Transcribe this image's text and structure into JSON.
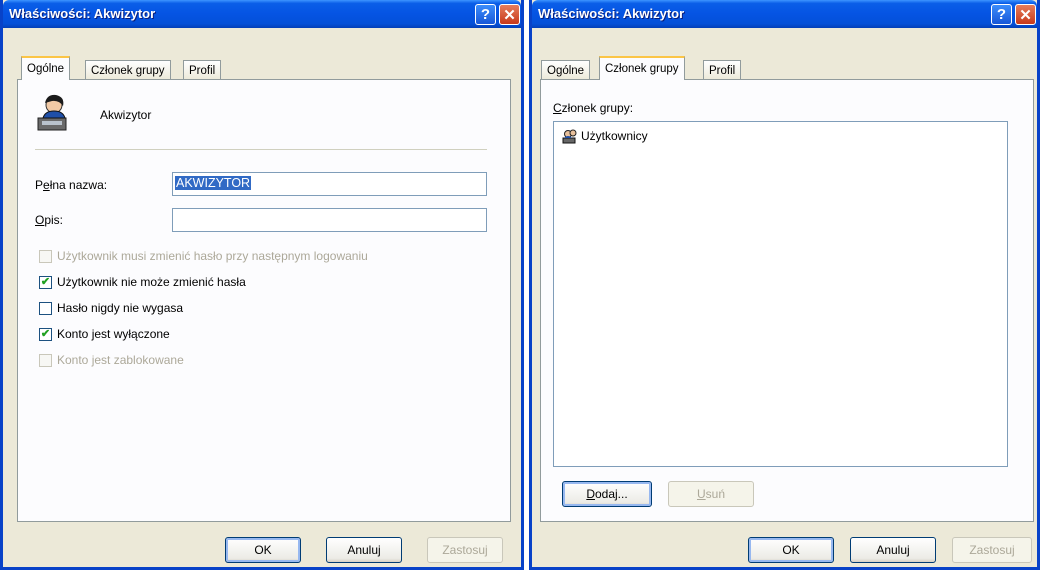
{
  "window1": {
    "title": "Właściwości: Akwizytor",
    "tabs": [
      "Ogólne",
      "Członek grupy",
      "Profil"
    ],
    "active_tab": "Ogólne",
    "user_name": "Akwizytor",
    "full_name_label": "Pełna nazwa:",
    "full_name_value": "AKWIZYTOR",
    "description_label": "Opis:",
    "description_value": "",
    "checkboxes": [
      {
        "label": "Użytkownik musi zmienić hasło przy następnym logowaniu",
        "checked": false,
        "enabled": false
      },
      {
        "label": "Użytkownik nie może zmienić hasła",
        "checked": true,
        "enabled": true
      },
      {
        "label": "Hasło nigdy nie wygasa",
        "checked": false,
        "enabled": true
      },
      {
        "label": "Konto jest wyłączone",
        "checked": true,
        "enabled": true
      },
      {
        "label": "Konto jest zablokowane",
        "checked": false,
        "enabled": false
      }
    ],
    "buttons": {
      "ok": "OK",
      "cancel": "Anuluj",
      "apply": "Zastosuj"
    }
  },
  "window2": {
    "title": "Właściwości: Akwizytor",
    "tabs": [
      "Ogólne",
      "Członek grupy",
      "Profil"
    ],
    "active_tab": "Członek grupy",
    "member_of_label": "Członek grupy:",
    "groups": [
      "Użytkownicy"
    ],
    "add_button": "Dodaj...",
    "remove_button": "Usuń",
    "buttons": {
      "ok": "OK",
      "cancel": "Anuluj",
      "apply": "Zastosuj"
    }
  },
  "icons": {
    "help": "help-icon",
    "close": "close-icon",
    "user": "user-icon",
    "group": "group-icon"
  },
  "colors": {
    "titlebar": "#0554e3",
    "dialog_bg": "#ece9d8",
    "tab_highlight": "#fbc546",
    "check": "#21a121"
  }
}
